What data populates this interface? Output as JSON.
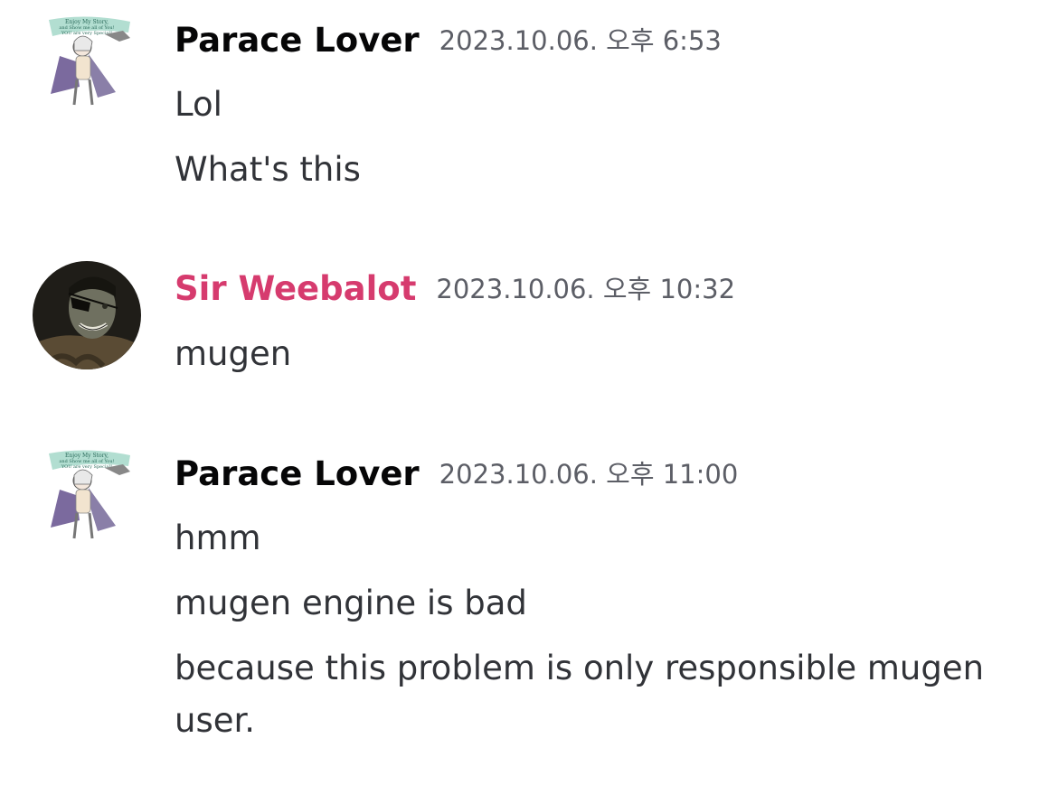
{
  "messages": [
    {
      "author": "Parace Lover",
      "timestamp": "2023.10.06. 오후 6:53",
      "avatar": "anime-character-avatar",
      "lines": [
        "Lol",
        "What's this"
      ]
    },
    {
      "author": "Sir Weebalot",
      "author_color": "#d63b6e",
      "timestamp": "2023.10.06. 오후 10:32",
      "avatar": "eyepatch-man-avatar",
      "lines": [
        "mugen"
      ]
    },
    {
      "author": "Parace Lover",
      "timestamp": "2023.10.06. 오후 11:00",
      "avatar": "anime-character-avatar",
      "lines": [
        "hmm",
        "mugen engine is bad",
        "because this problem is only responsible mugen user."
      ]
    }
  ],
  "avatar_text": [
    "Enjoy My Story,",
    "and Show me all of You!",
    "YOU are very Special!"
  ]
}
